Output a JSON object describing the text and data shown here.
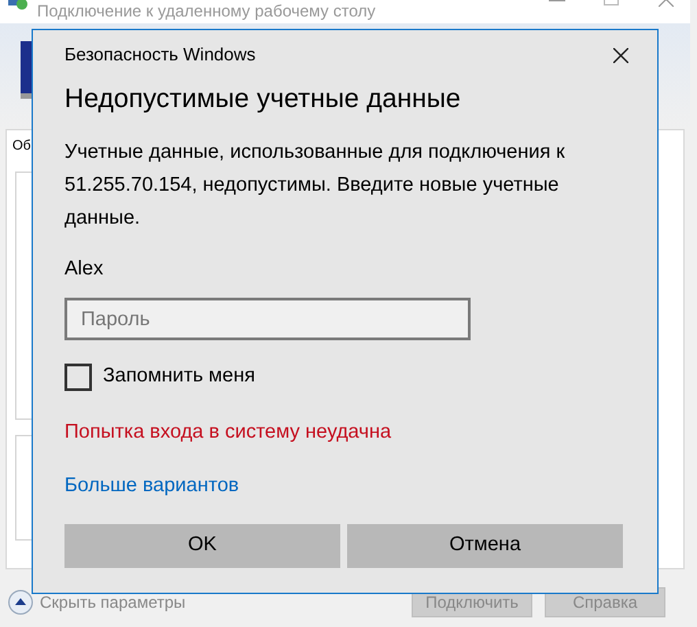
{
  "window": {
    "title": "Подключение к удаленному рабочему столу"
  },
  "tab": {
    "label": "Об",
    "selected": true
  },
  "groups": [
    {
      "kind": "group"
    },
    {
      "kind": "group"
    }
  ],
  "footer": {
    "toggle": "Скрыть параметры",
    "buttons": [
      {
        "label": "Подключить",
        "disabled": true
      },
      {
        "label": "Справка",
        "disabled": true
      }
    ]
  },
  "dialog": {
    "title": "Безопасность Windows",
    "heading": "Недопустимые учетные данные",
    "message": "Учетные данные, использованные для подключения к 51.255.70.154, недопустимы. Введите новые учетные данные.",
    "username": "Alex",
    "password": {
      "placeholder": "Пароль"
    },
    "remember": {
      "label": "Запомнить меня",
      "checked": false
    },
    "error": "Попытка входа в систему неудачна",
    "more_link": "Больше вариантов",
    "buttons": [
      "OK",
      "Отмена"
    ]
  }
}
